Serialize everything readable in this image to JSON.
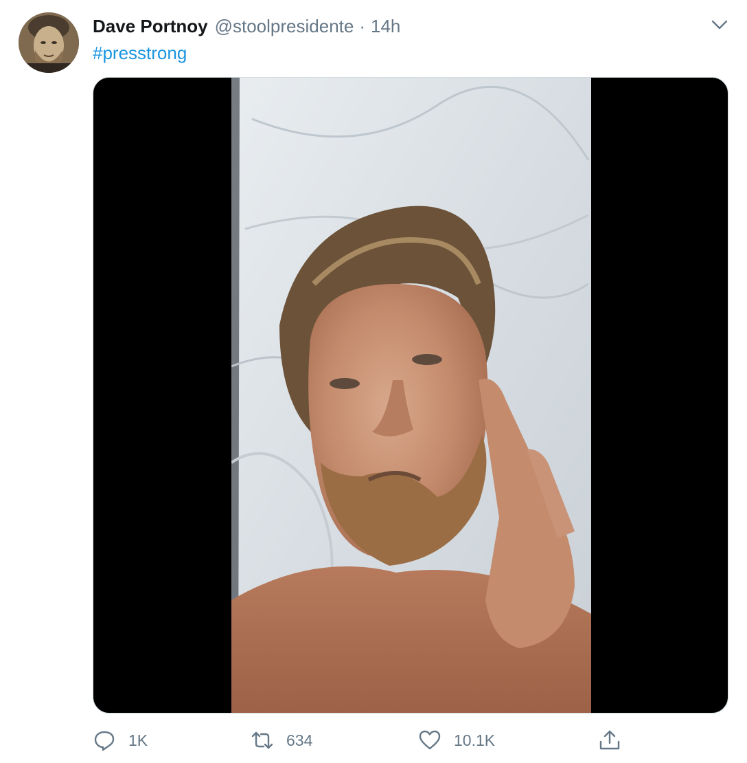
{
  "author": {
    "display_name": "Dave Portnoy",
    "handle": "@stoolpresidente",
    "separator": "·",
    "timestamp": "14h",
    "avatar_icon": "profile-photo"
  },
  "tweet": {
    "text": "#presstrong",
    "hashtag_color": "#1b95e0"
  },
  "menu": {
    "icon": "chevron-down-icon"
  },
  "media": {
    "type": "video",
    "description_icon": "video-thumbnail"
  },
  "actions": {
    "reply": {
      "icon": "reply-icon",
      "count": "1K"
    },
    "retweet": {
      "icon": "retweet-icon",
      "count": "634"
    },
    "like": {
      "icon": "heart-icon",
      "count": "10.1K"
    },
    "share": {
      "icon": "share-icon"
    }
  },
  "colors": {
    "secondary_text": "#657786",
    "primary_text": "#14171a",
    "link": "#1b95e0"
  }
}
